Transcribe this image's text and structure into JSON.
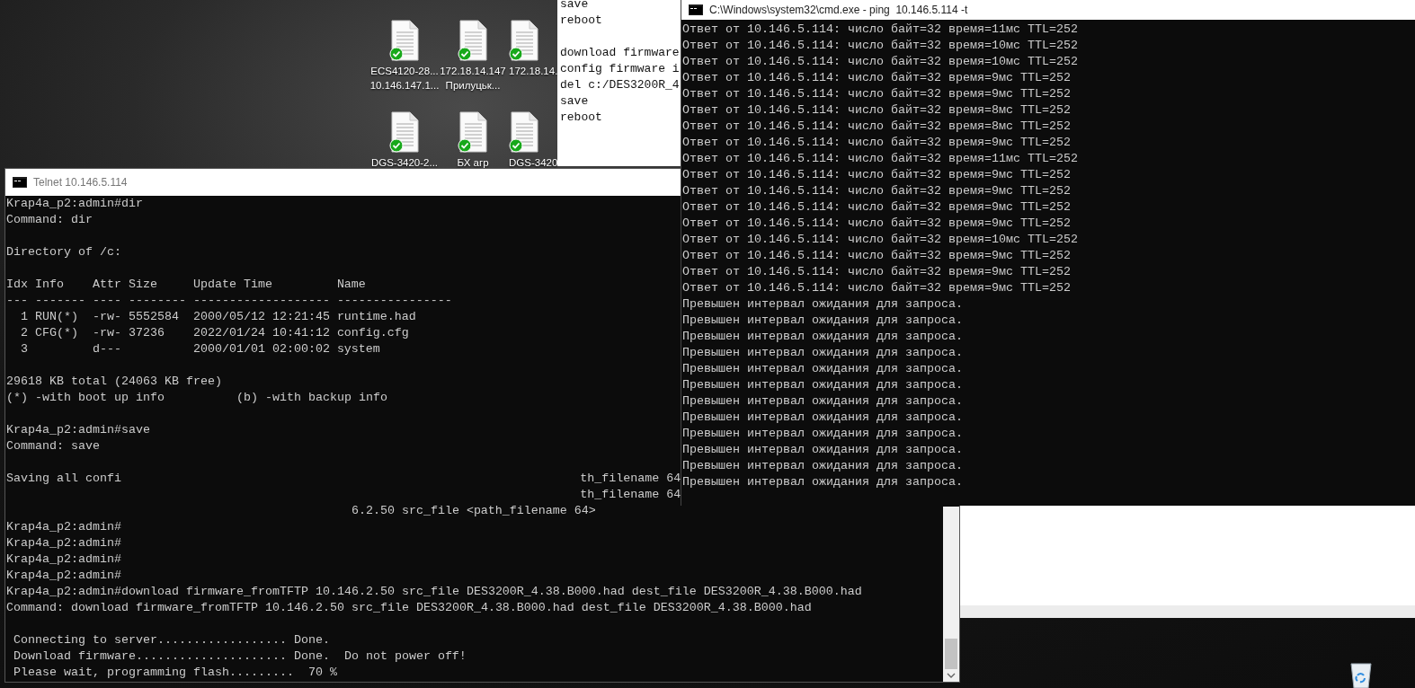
{
  "desktop": {
    "icons": [
      {
        "label_lines": [
          "ECS4120-28...",
          "10.146.147.1..."
        ],
        "synced": true
      },
      {
        "label_lines": [
          "172.18.14.147",
          "Прилуцьк..."
        ],
        "synced": true
      },
      {
        "label_lines": [
          "172.18.14."
        ],
        "synced": true
      },
      {
        "label_lines": [
          "DGS-3420-2..."
        ],
        "synced": true
      },
      {
        "label_lines": [
          "БХ агр"
        ],
        "synced": true
      },
      {
        "label_lines": [
          "DGS-3420"
        ],
        "synced": true
      }
    ]
  },
  "notepad": {
    "groups": [
      [
        "save",
        "reboot"
      ],
      [
        "download firmware",
        "config firmware i",
        "del c:/DES3200R_4",
        "save",
        "reboot"
      ]
    ]
  },
  "telnet": {
    "title": "Telnet 10.146.5.114",
    "lines": [
      {
        "kind": "text",
        "text": "Krap4a_p2:admin#dir"
      },
      {
        "kind": "text",
        "text": "Command: dir"
      },
      {
        "kind": "blank"
      },
      {
        "kind": "text",
        "text": "Directory of /c:"
      },
      {
        "kind": "blank"
      },
      {
        "kind": "table",
        "columns": [
          "Idx",
          "Info",
          "Attr",
          "Size",
          "Update Time",
          "Name"
        ],
        "separators": [
          "---",
          "-------",
          "----",
          "--------",
          "-------------------",
          "----------------"
        ],
        "rows": [
          [
            "1",
            "RUN(*)",
            "-rw-",
            "5552584",
            "2000/05/12 12:21:45",
            "runtime.had"
          ],
          [
            "2",
            "CFG(*)",
            "-rw-",
            "37236",
            "2022/01/24 10:41:12",
            "config.cfg"
          ],
          [
            "3",
            null,
            "d---",
            null,
            "2000/01/01 02:00:02",
            "system"
          ]
        ]
      },
      {
        "kind": "blank"
      },
      {
        "kind": "text",
        "text": "29618 KB total (24063 KB free)"
      },
      {
        "kind": "legend",
        "texts": [
          "(*) -with boot up info",
          "(b) -with backup info"
        ]
      },
      {
        "kind": "blank"
      },
      {
        "kind": "text",
        "text": "Krap4a_p2:admin#save"
      },
      {
        "kind": "text",
        "text": "Command: save"
      },
      {
        "kind": "blank"
      },
      {
        "kind": "split",
        "texts": [
          "Saving all confi",
          "th_filename 64"
        ]
      },
      {
        "kind": "split",
        "texts": [
          "th_filename 64"
        ]
      },
      {
        "kind": "indent",
        "text": "6.2.50 src_file <path_filename 64>"
      },
      {
        "kind": "text",
        "text": "Krap4a_p2:admin#"
      },
      {
        "kind": "text",
        "text": "Krap4a_p2:admin#"
      },
      {
        "kind": "text",
        "text": "Krap4a_p2:admin#"
      },
      {
        "kind": "text",
        "text": "Krap4a_p2:admin#"
      },
      {
        "kind": "text",
        "text": "Krap4a_p2:admin#download firmware_fromTFTP 10.146.2.50 src_file DES3200R_4.38.B000.had dest_file DES3200R_4.38.B000.had"
      },
      {
        "kind": "text",
        "text": "Command: download firmware_fromTFTP 10.146.2.50 src_file DES3200R_4.38.B000.had dest_file DES3200R_4.38.B000.had"
      },
      {
        "kind": "blank"
      },
      {
        "kind": "indent1",
        "text": "Connecting to server.................. Done."
      },
      {
        "kind": "indent1",
        "text": "Download firmware..................... Done.  Do not power off!"
      },
      {
        "kind": "indent1",
        "text": "Please wait, programming flash.........  70 %"
      }
    ]
  },
  "cmd": {
    "title": "C:\\Windows\\system32\\cmd.exe - ping  10.146.5.114 -t",
    "lines": [
      "Ответ от 10.146.5.114: число байт=32 время=11мс TTL=252",
      "Ответ от 10.146.5.114: число байт=32 время=10мс TTL=252",
      "Ответ от 10.146.5.114: число байт=32 время=10мс TTL=252",
      "Ответ от 10.146.5.114: число байт=32 время=9мс TTL=252",
      "Ответ от 10.146.5.114: число байт=32 время=9мс TTL=252",
      "Ответ от 10.146.5.114: число байт=32 время=8мс TTL=252",
      "Ответ от 10.146.5.114: число байт=32 время=8мс TTL=252",
      "Ответ от 10.146.5.114: число байт=32 время=9мс TTL=252",
      "Ответ от 10.146.5.114: число байт=32 время=11мс TTL=252",
      "Ответ от 10.146.5.114: число байт=32 время=9мс TTL=252",
      "Ответ от 10.146.5.114: число байт=32 время=9мс TTL=252",
      "Ответ от 10.146.5.114: число байт=32 время=9мс TTL=252",
      "Ответ от 10.146.5.114: число байт=32 время=9мс TTL=252",
      "Ответ от 10.146.5.114: число байт=32 время=10мс TTL=252",
      "Ответ от 10.146.5.114: число байт=32 время=9мс TTL=252",
      "Ответ от 10.146.5.114: число байт=32 время=9мс TTL=252",
      "Ответ от 10.146.5.114: число байт=32 время=9мс TTL=252",
      "Превышен интервал ожидания для запроса.",
      "Превышен интервал ожидания для запроса.",
      "Превышен интервал ожидания для запроса.",
      "Превышен интервал ожидания для запроса.",
      "Превышен интервал ожидания для запроса.",
      "Превышен интервал ожидания для запроса.",
      "Превышен интервал ожидания для запроса.",
      "Превышен интервал ожидания для запроса.",
      "Превышен интервал ожидания для запроса.",
      "Превышен интервал ожидания для запроса.",
      "Превышен интервал ожидания для запроса.",
      "Превышен интервал ожидания для запроса."
    ]
  }
}
